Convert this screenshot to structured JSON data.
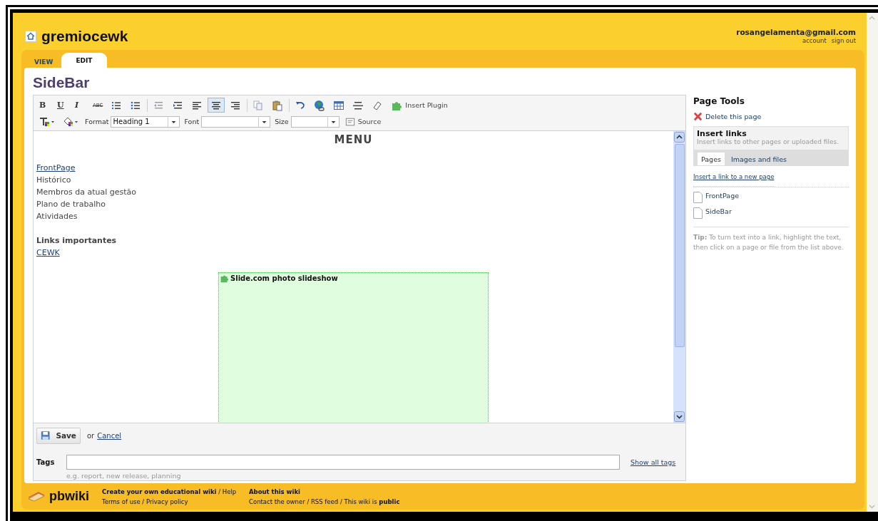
{
  "header": {
    "site": "gremiocewk",
    "user": "rosangelamenta@gmail.com",
    "links": [
      "account",
      "sign out"
    ]
  },
  "tabs": [
    {
      "label": "VIEW",
      "selected": false
    },
    {
      "label": "EDIT",
      "selected": true
    }
  ],
  "page_title": "SideBar",
  "toolbar": {
    "groups": [
      [
        {
          "kind": "bold",
          "label": "B",
          "selected": false
        },
        {
          "kind": "underline",
          "label": "U",
          "selected": false
        },
        {
          "kind": "italic",
          "label": "I",
          "selected": false
        },
        {
          "kind": "strike",
          "label": "ABC",
          "selected": false
        },
        {
          "kind": "numbered-list",
          "selected": false
        },
        {
          "kind": "bullet-list",
          "selected": false
        }
      ],
      [
        {
          "kind": "outdent",
          "selected": false
        },
        {
          "kind": "indent",
          "selected": false
        },
        {
          "kind": "align-left",
          "selected": false
        },
        {
          "kind": "align-center",
          "selected": true
        },
        {
          "kind": "align-right",
          "selected": false
        }
      ],
      [
        {
          "kind": "copy",
          "selected": false
        },
        {
          "kind": "paste",
          "selected": false
        }
      ],
      [
        {
          "kind": "undo",
          "selected": false
        },
        {
          "kind": "link",
          "selected": false
        },
        {
          "kind": "table",
          "selected": false
        },
        {
          "kind": "rule",
          "selected": false
        },
        {
          "kind": "eraser",
          "selected": false
        },
        {
          "kind": "plugin",
          "label": "Insert Plugin",
          "selected": false
        }
      ]
    ],
    "selects": [
      {
        "label": "Format",
        "value": "Heading 1"
      },
      {
        "label": "Font"
      },
      {
        "label": "Size"
      }
    ],
    "source": "Source"
  },
  "document": {
    "heading": "MENU",
    "lines": [
      {
        "kind": "link",
        "text": "FrontPage"
      },
      {
        "kind": "text",
        "text": "Histórico"
      },
      {
        "kind": "text",
        "text": "Membros da atual gestão"
      },
      {
        "kind": "text",
        "text": "Plano de trabalho"
      },
      {
        "kind": "text",
        "text": "Atividades"
      },
      {
        "kind": "gap"
      },
      {
        "kind": "bold",
        "text": "Links importantes"
      },
      {
        "kind": "link",
        "text": "CEWK"
      }
    ],
    "plugin": {
      "title": "Slide.com photo slideshow"
    }
  },
  "editor_footer": {
    "save": "Save",
    "or": "or",
    "cancel": "Cancel",
    "tags_label": "Tags",
    "tags_hint": "e.g. report, new release, planning",
    "show_all": "Show all tags"
  },
  "page_tools": {
    "title": "Page Tools",
    "delete": "Delete this page",
    "insert_links": {
      "title": "Insert links",
      "subtitle": "Insert links to other pages or uploaded files.",
      "tabs": [
        {
          "label": "Pages",
          "selected": true
        },
        {
          "label": "Images and files",
          "selected": false
        }
      ],
      "new_link": "Insert a link to a new page",
      "pages": [
        "FrontPage",
        "SideBar"
      ],
      "tip": "**Tip:** To turn text into a link, highlight the text, then click on a page or file from the list above."
    }
  },
  "footer": {
    "brand": "pbwiki",
    "columns": [
      [
        "**Create your own educational wiki** / Help",
        "Terms of use / Privacy policy"
      ],
      [
        "**About this wiki**",
        "Contact the owner / RSS feed / This wiki is **public**"
      ]
    ]
  }
}
